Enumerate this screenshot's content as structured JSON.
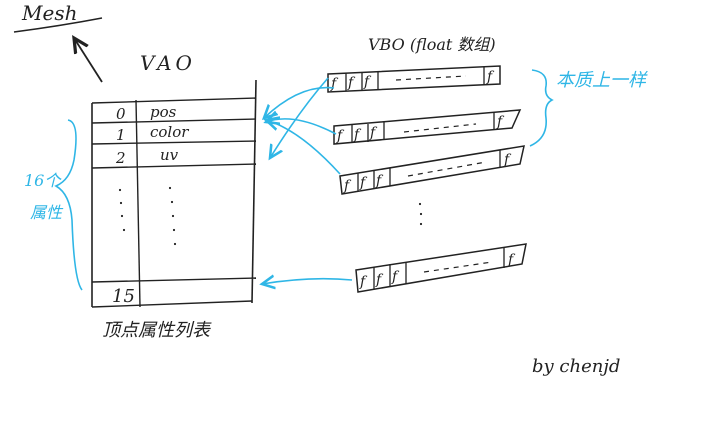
{
  "mesh": {
    "label": "Mesh"
  },
  "vao": {
    "title": "VAO",
    "rows": [
      {
        "index": "0",
        "name": "pos"
      },
      {
        "index": "1",
        "name": "color"
      },
      {
        "index": "2",
        "name": "uv"
      }
    ],
    "last_index": "15",
    "caption": "顶点属性列表"
  },
  "side_note": {
    "count": "16个",
    "word": "属性"
  },
  "vbo": {
    "title": "VBO (float 数组)",
    "cell": "f",
    "brace_note": "本质上一样"
  },
  "signature": "by chenjd",
  "colors": {
    "ink": "#222222",
    "accent": "#2fb6e6"
  }
}
